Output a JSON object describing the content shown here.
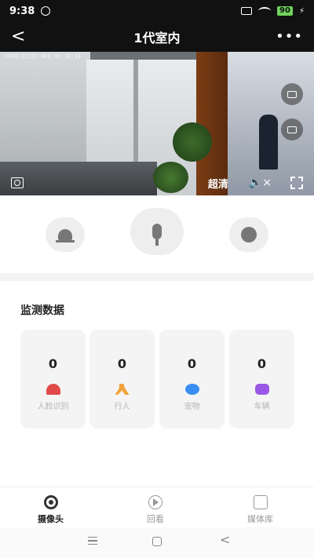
{
  "status_bar": {
    "time": "9:38",
    "battery": "90"
  },
  "header": {
    "title": "1代室内",
    "back_glyph": "<",
    "more_glyph": "•••"
  },
  "video": {
    "timestamp": "2020/12/23 WED 09:38:14",
    "quality_label": "超清",
    "mute_glyph": "🔈×"
  },
  "monitor": {
    "title": "监测数据",
    "cards": [
      {
        "count": "0",
        "label": "人脸识别",
        "icon": "face-icon",
        "color": "#e04a4a"
      },
      {
        "count": "0",
        "label": "行人",
        "icon": "walk-icon",
        "color": "#f2a43a"
      },
      {
        "count": "0",
        "label": "宠物",
        "icon": "paw-icon",
        "color": "#3a8df2"
      },
      {
        "count": "0",
        "label": "车辆",
        "icon": "car-icon",
        "color": "#9b58e6"
      }
    ]
  },
  "tabs": [
    {
      "label": "摄像头",
      "icon": "camera-icon",
      "active": true
    },
    {
      "label": "回看",
      "icon": "playback-icon",
      "active": false
    },
    {
      "label": "媒体库",
      "icon": "media-library-icon",
      "active": false
    }
  ],
  "nav": {
    "back_glyph": "<"
  }
}
